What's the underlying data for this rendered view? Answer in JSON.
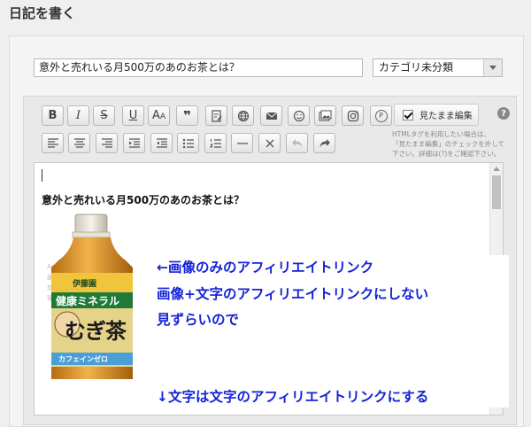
{
  "page": {
    "title": "日記を書く"
  },
  "form": {
    "title_value": "意外と売れいる月500万のあのお茶とは？",
    "category_selected": "カテゴリ未分類"
  },
  "toolbar": {
    "row1": [
      "bold",
      "italic",
      "strikethrough",
      "underline",
      "font-size",
      "quote",
      "image-edit",
      "globe",
      "mail",
      "smiley",
      "picture",
      "instagram",
      "pinterest"
    ],
    "row2": [
      "align-left",
      "align-center",
      "align-right",
      "indent",
      "outdent",
      "bullet-list",
      "numbered-list",
      "horizontal-rule",
      "clear-format",
      "undo",
      "redo"
    ],
    "bold_label": "B",
    "italic_label": "I",
    "strike_label": "S",
    "underline_label": "U",
    "fontsize_label": "A",
    "quote_label": "❞",
    "pinterest_label": "P",
    "wysiwyg_label": "見たまま編集",
    "help_label": "?"
  },
  "hint": {
    "line1": "HTMLタグを利用したい場合は、",
    "line2": "「見たまま編集」のチェックを外して",
    "line3": "下さい。詳細は(?)をご確認下さい。"
  },
  "editor": {
    "heading": "意外と売れいる月500万のあのお茶とは？",
    "alt_lines": [
      "Amazon",
      "画像",
      "加",
      "理"
    ],
    "product": {
      "brand": "伊藤園",
      "line1": "健康ミネラル",
      "line2": "むぎ茶",
      "badge": "カフェインゼロ"
    }
  },
  "annotations": {
    "line1": "←画像のみのアフィリエイトリンク",
    "line2": "画像+文字のアフィリエイトリンクにしない",
    "line3": "見ずらいので",
    "line4": "↓文字は文字のアフィリエイトリンクにする"
  },
  "colors": {
    "annotation_text": "#1523d6",
    "page_bg": "#efefef"
  }
}
